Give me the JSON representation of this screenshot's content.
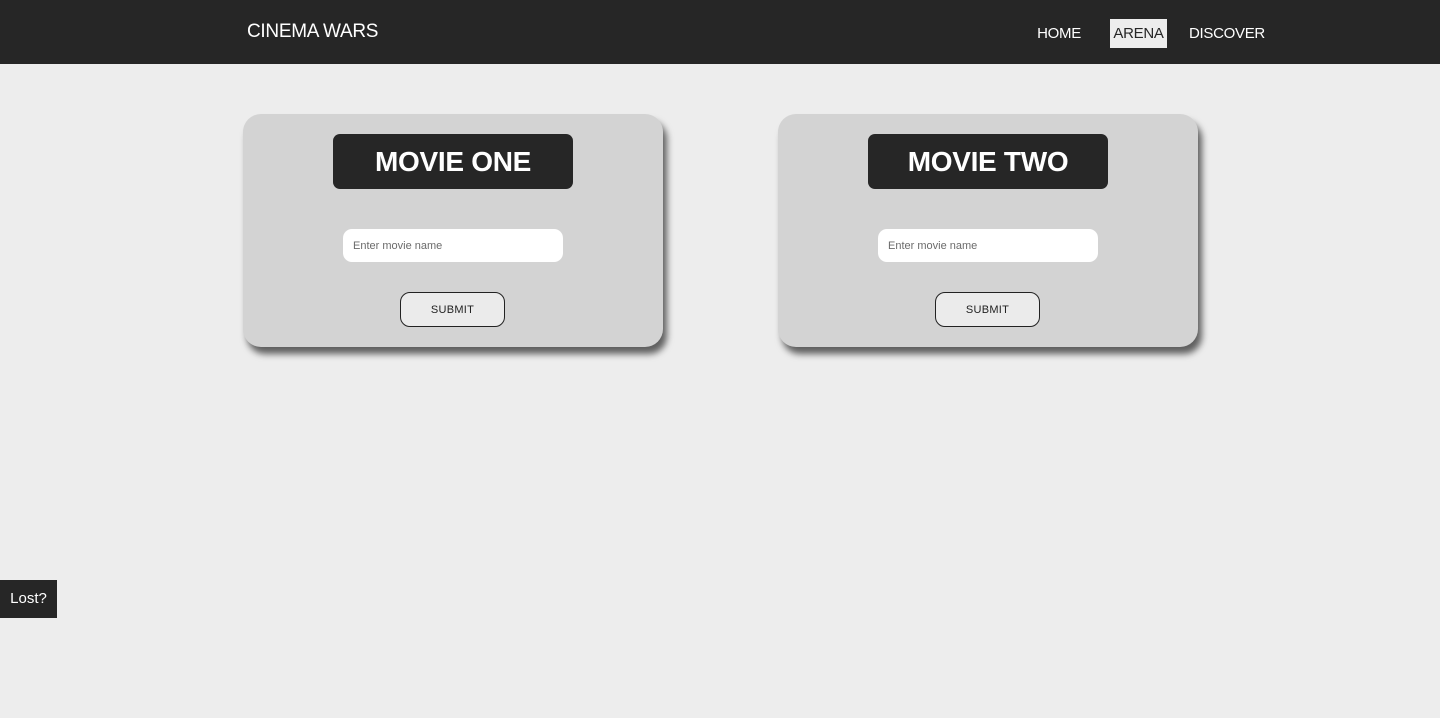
{
  "header": {
    "brand": "CINEMA WARS",
    "nav": {
      "home": "HOME",
      "arena": "ARENA",
      "discover": "DISCOVER"
    },
    "active_nav": "ARENA"
  },
  "cards": [
    {
      "title": "MOVIE ONE",
      "input_placeholder": "Enter movie name",
      "input_value": "",
      "submit_label": "SUBMIT"
    },
    {
      "title": "MOVIE TWO",
      "input_placeholder": "Enter movie name",
      "input_value": "",
      "submit_label": "SUBMIT"
    }
  ],
  "help": {
    "label": "Lost?"
  },
  "colors": {
    "navbar": "#262626",
    "background": "#ededed",
    "card": "#d3d3d3",
    "title_bg": "#262626"
  }
}
